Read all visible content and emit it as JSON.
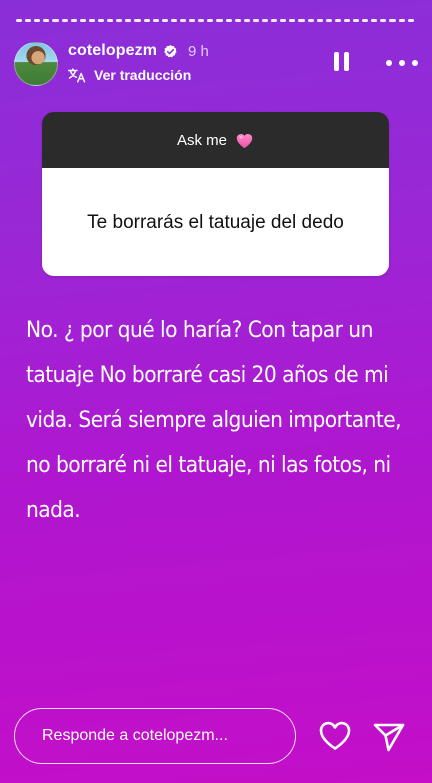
{
  "story": {
    "progress_segments": [
      1,
      1,
      1,
      1,
      1,
      1,
      1,
      1,
      1,
      1,
      1,
      1,
      1,
      1,
      1,
      1,
      1,
      1,
      1,
      1,
      1,
      1,
      1,
      1,
      1,
      1,
      1,
      1,
      1,
      1,
      1,
      1,
      1,
      1,
      1,
      1,
      1,
      1,
      1,
      1,
      1,
      1,
      1,
      1
    ]
  },
  "header": {
    "username": "cotelopezm",
    "timestamp": "9 h",
    "translate_label": "Ver traducción",
    "verified_icon": "verified-badge-icon",
    "translate_icon": "translate-icon",
    "pause_icon": "pause-icon",
    "more_icon": "more-options-icon"
  },
  "question_sticker": {
    "header_label": "Ask me",
    "header_emoji": "pink-heart-icon",
    "question": "Te borrarás el tatuaje del dedo"
  },
  "answer": {
    "text": "No. ¿ por qué lo haría? Con tapar un tatuaje No  borraré casi 20 años de mi vida. Será siempre alguien importante, no borraré ni el tatuaje, ni las fotos, ni nada."
  },
  "footer": {
    "reply_placeholder": "Responde a cotelopezm...",
    "like_icon": "heart-outline-icon",
    "send_icon": "send-icon"
  },
  "colors": {
    "gradient_top": "#8a2fd8",
    "gradient_bottom": "#c40ec8",
    "card_header": "#2b2b2b",
    "card_body": "#ffffff"
  }
}
